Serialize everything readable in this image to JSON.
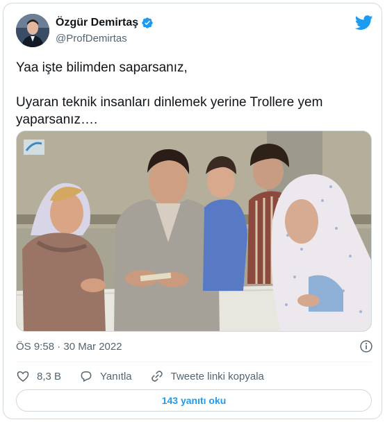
{
  "author": {
    "display_name": "Özgür Demirtaş",
    "handle": "@ProfDemirtas",
    "verified": true
  },
  "tweet": {
    "line1": "Yaa işte bilimden saparsanız,",
    "line2": "Uyaran teknik insanları dinlemek yerine Trollere yem",
    "line3": "yaparsanız…."
  },
  "meta": {
    "timestamp": "ÖS 9:58 · 30 Mar 2022"
  },
  "actions": {
    "likes": "8,3 B",
    "reply_label": "Yanıtla",
    "copy_label": "Tweete linki kopyala"
  },
  "replies_button": "143 yanıtı oku",
  "colors": {
    "accent": "#1d9bf0",
    "text": "#0f1419",
    "secondary": "#536471",
    "border": "#cfd9de"
  },
  "icons": [
    "verified-badge-icon",
    "twitter-bird-icon",
    "info-icon",
    "heart-icon",
    "reply-icon",
    "link-icon"
  ]
}
